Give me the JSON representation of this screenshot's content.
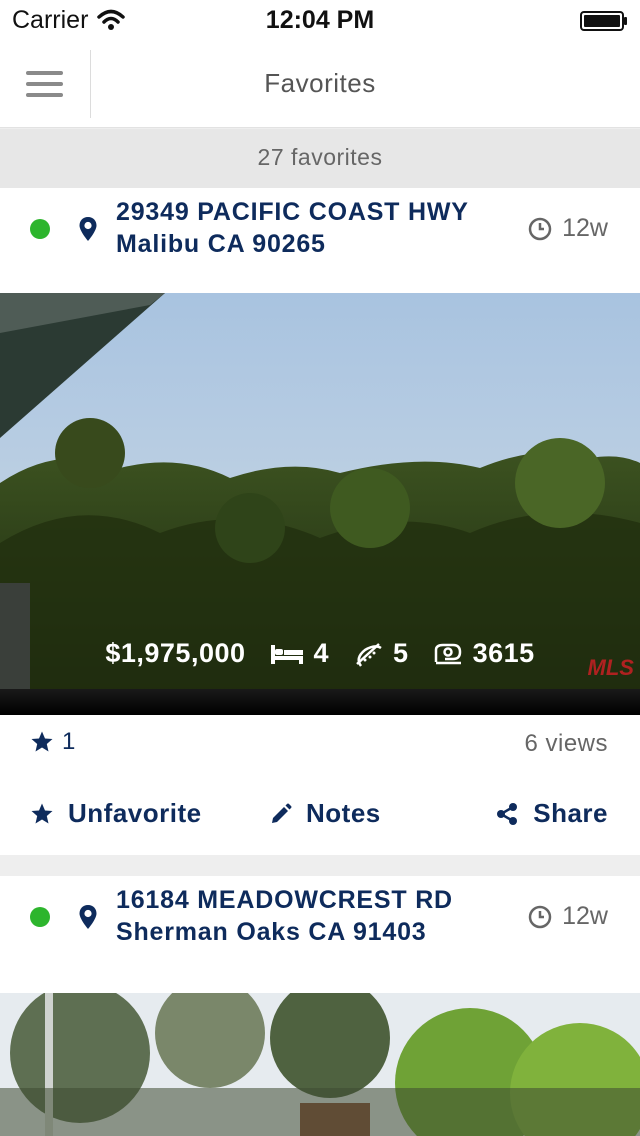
{
  "status_bar": {
    "carrier": "Carrier",
    "time": "12:04 PM"
  },
  "nav": {
    "title": "Favorites"
  },
  "summary": {
    "count_text": "27 favorites"
  },
  "listings": [
    {
      "address_line1": "29349 PACIFIC COAST HWY",
      "address_line2": "Malibu CA 90265",
      "age": "12w",
      "status_color": "#2db52d",
      "price": "$1,975,000",
      "beds": "4",
      "baths": "5",
      "sqft": "3615",
      "stars": "1",
      "views": "6 views",
      "actions": {
        "unfavorite": "Unfavorite",
        "notes": "Notes",
        "share": "Share"
      }
    },
    {
      "address_line1": "16184 MEADOWCREST RD",
      "address_line2": "Sherman Oaks CA 91403",
      "age": "12w",
      "status_color": "#2db52d"
    }
  ],
  "colors": {
    "accent": "#0e2b5c",
    "status_active": "#2db52d",
    "mls_red": "#c81f24"
  },
  "icons": [
    "wifi-icon",
    "battery-icon",
    "menu-icon",
    "map-pin-icon",
    "clock-icon",
    "bed-icon",
    "bath-icon",
    "area-icon",
    "star-icon",
    "pencil-icon",
    "share-icon"
  ]
}
